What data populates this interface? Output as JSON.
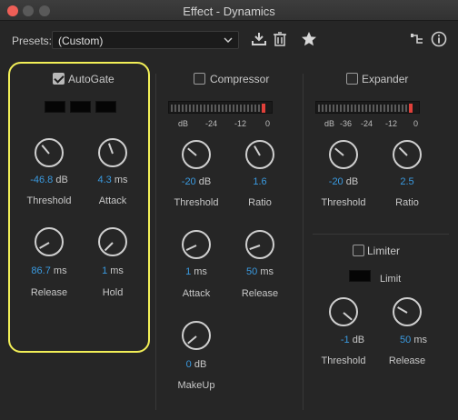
{
  "window": {
    "title": "Effect - Dynamics"
  },
  "toolbar": {
    "presets_label": "Presets:",
    "preset_value": "(Custom)"
  },
  "icons": {
    "save": "save-preset-icon",
    "delete": "delete-preset-icon",
    "favorite": "star-icon",
    "routing": "routing-icon",
    "info": "info-icon"
  },
  "autogate": {
    "label": "AutoGate",
    "enabled": true,
    "threshold": {
      "value": "-46.8",
      "unit": "dB",
      "label": "Threshold"
    },
    "attack": {
      "value": "4.3",
      "unit": "ms",
      "label": "Attack"
    },
    "release": {
      "value": "86.7",
      "unit": "ms",
      "label": "Release"
    },
    "hold": {
      "value": "1",
      "unit": "ms",
      "label": "Hold"
    }
  },
  "compressor": {
    "label": "Compressor",
    "enabled": false,
    "meter_ticks": [
      "dB",
      "-24",
      "-12",
      "0"
    ],
    "threshold": {
      "value": "-20",
      "unit": "dB",
      "label": "Threshold"
    },
    "ratio": {
      "value": "1.6",
      "unit": "",
      "label": "Ratio"
    },
    "attack": {
      "value": "1",
      "unit": "ms",
      "label": "Attack"
    },
    "release": {
      "value": "50",
      "unit": "ms",
      "label": "Release"
    },
    "makeup": {
      "value": "0",
      "unit": "dB",
      "label": "MakeUp"
    }
  },
  "expander": {
    "label": "Expander",
    "enabled": false,
    "meter_ticks": [
      "dB",
      "-36",
      "-24",
      "-12",
      "0"
    ],
    "threshold": {
      "value": "-20",
      "unit": "dB",
      "label": "Threshold"
    },
    "ratio": {
      "value": "2.5",
      "unit": "",
      "label": "Ratio"
    }
  },
  "limiter": {
    "label": "Limiter",
    "enabled": false,
    "limit_label": "Limit",
    "threshold": {
      "value": "-1",
      "unit": "dB",
      "label": "Threshold"
    },
    "release": {
      "value": "50",
      "unit": "ms",
      "label": "Release"
    }
  },
  "colors": {
    "value_accent": "#3a9ae0",
    "highlight": "#f2ef57",
    "meter_peak": "#e0403a"
  }
}
